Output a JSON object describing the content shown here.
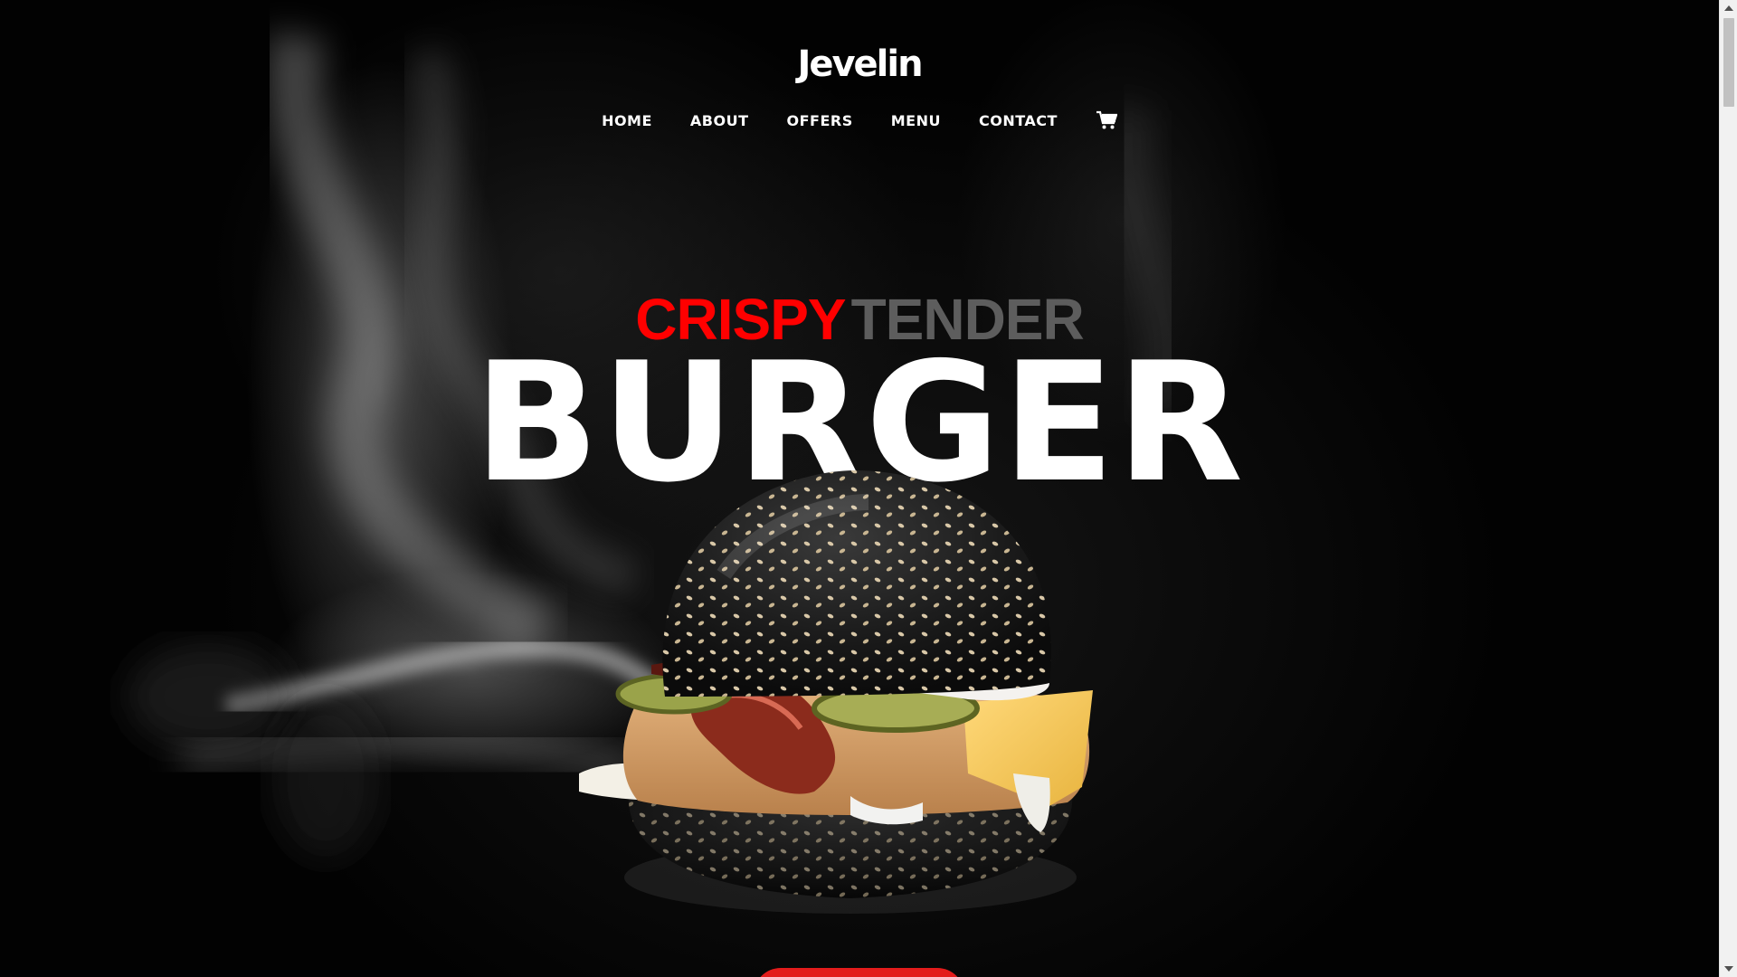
{
  "brand": {
    "logo": "Jevelin"
  },
  "nav": {
    "items": [
      {
        "label": "HOME"
      },
      {
        "label": "ABOUT"
      },
      {
        "label": "OFFERS"
      },
      {
        "label": "MENU"
      },
      {
        "label": "CONTACT"
      }
    ],
    "cart_icon": "cart-icon"
  },
  "hero": {
    "sub_red": "CRISPY",
    "sub_grey": "TENDER",
    "title": "BURGER",
    "image": "black-bun-burger-photo"
  },
  "colors": {
    "accent_red": "#ff0000",
    "cta_red": "#e31b1b",
    "subtitle_grey": "#5d5d5d",
    "background": "#000000"
  }
}
